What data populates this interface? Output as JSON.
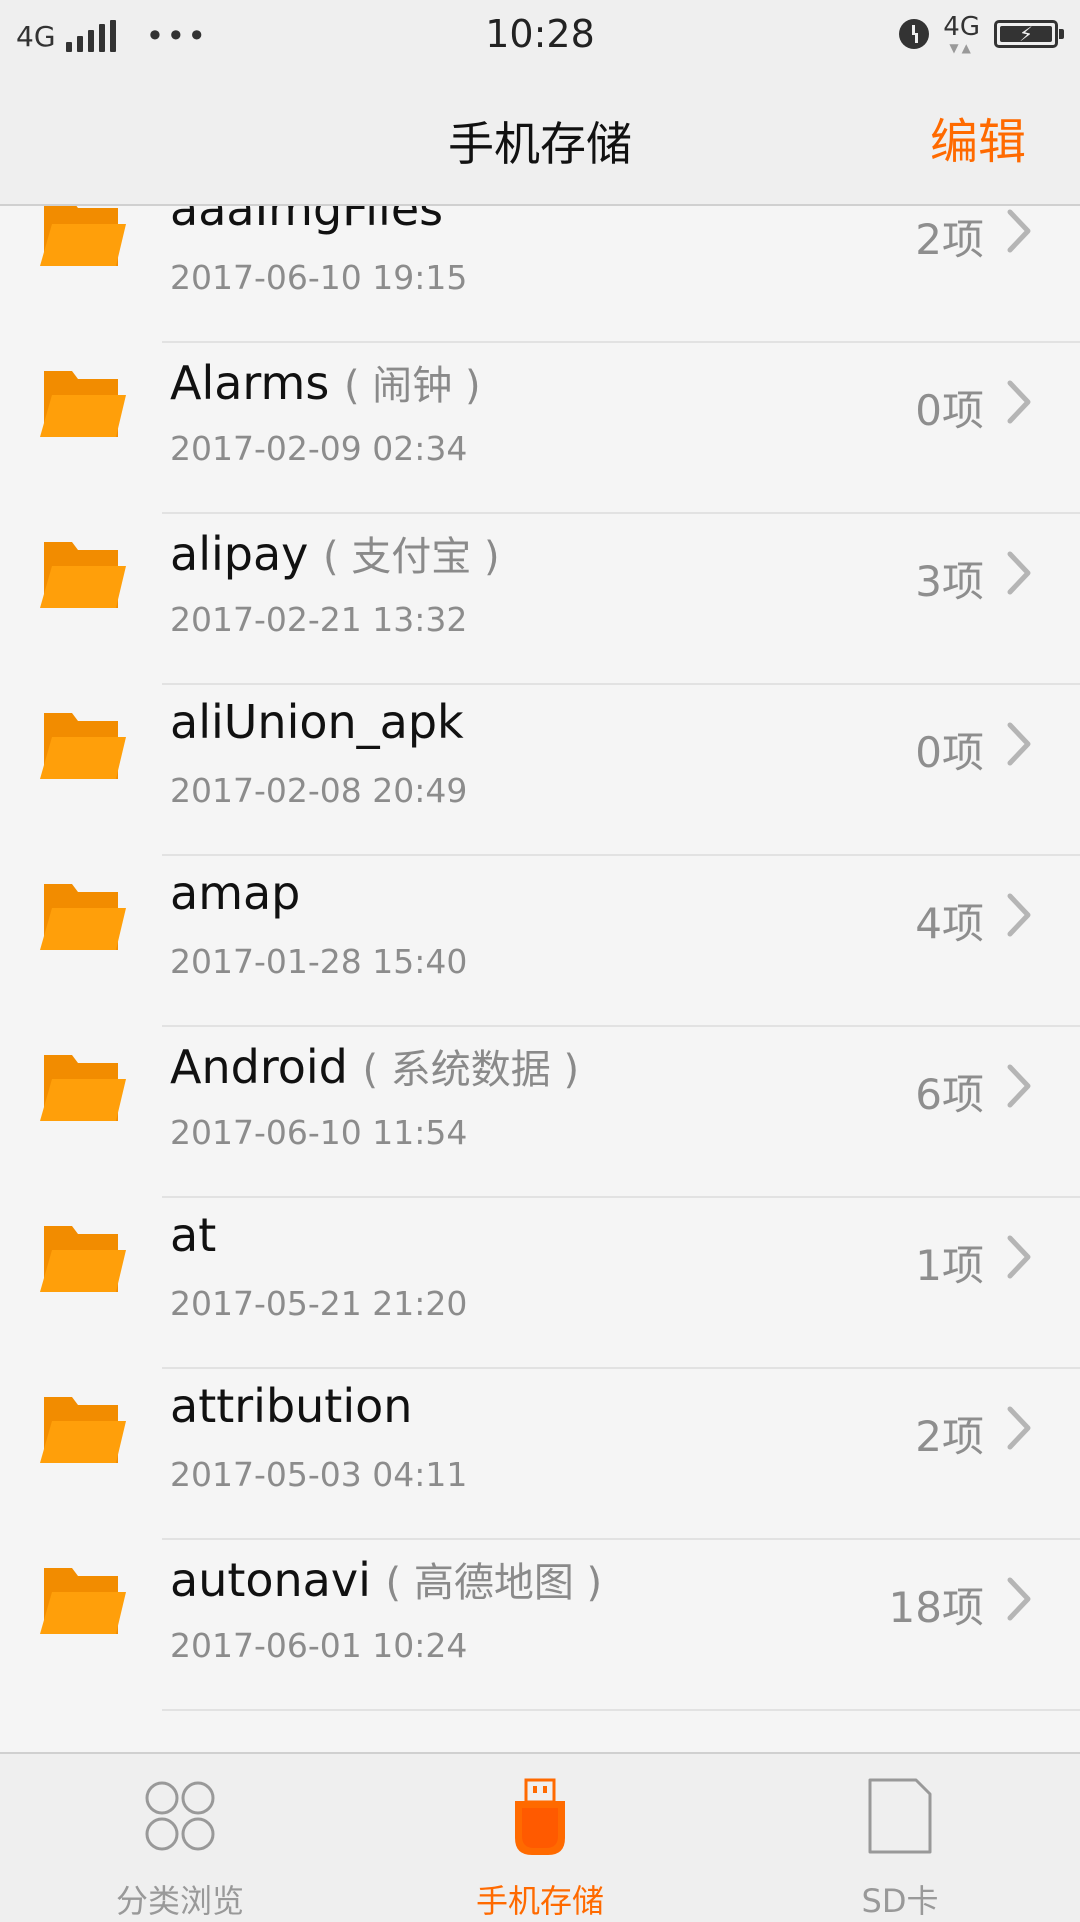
{
  "status_bar": {
    "network_left": "4G",
    "dots": "•••",
    "time": "10:28",
    "network_right": "4G"
  },
  "header": {
    "title": "手机存储",
    "edit_label": "编辑"
  },
  "colors": {
    "accent": "#ff6a00",
    "folder": "#ff9f0a",
    "folder_back": "#f28c00"
  },
  "folders": [
    {
      "name": "aaaImgFiles",
      "alias": "",
      "date": "2017-06-10 19:15",
      "count": "2项"
    },
    {
      "name": "Alarms",
      "alias": "( 闹钟 )",
      "date": "2017-02-09 02:34",
      "count": "0项"
    },
    {
      "name": "alipay",
      "alias": "( 支付宝 )",
      "date": "2017-02-21 13:32",
      "count": "3项"
    },
    {
      "name": "aliUnion_apk",
      "alias": "",
      "date": "2017-02-08 20:49",
      "count": "0项"
    },
    {
      "name": "amap",
      "alias": "",
      "date": "2017-01-28 15:40",
      "count": "4项"
    },
    {
      "name": "Android",
      "alias": "( 系统数据 )",
      "date": "2017-06-10 11:54",
      "count": "6项"
    },
    {
      "name": "at",
      "alias": "",
      "date": "2017-05-21 21:20",
      "count": "1项"
    },
    {
      "name": "attribution",
      "alias": "",
      "date": "2017-05-03 04:11",
      "count": "2项"
    },
    {
      "name": "autonavi",
      "alias": "( 高德地图 )",
      "date": "2017-06-01 10:24",
      "count": "18项"
    }
  ],
  "bottom_nav": [
    {
      "label": "分类浏览",
      "icon": "category-grid-icon",
      "active": false
    },
    {
      "label": "手机存储",
      "icon": "phone-storage-icon",
      "active": true
    },
    {
      "label": "SD卡",
      "icon": "sd-card-icon",
      "active": false
    }
  ]
}
